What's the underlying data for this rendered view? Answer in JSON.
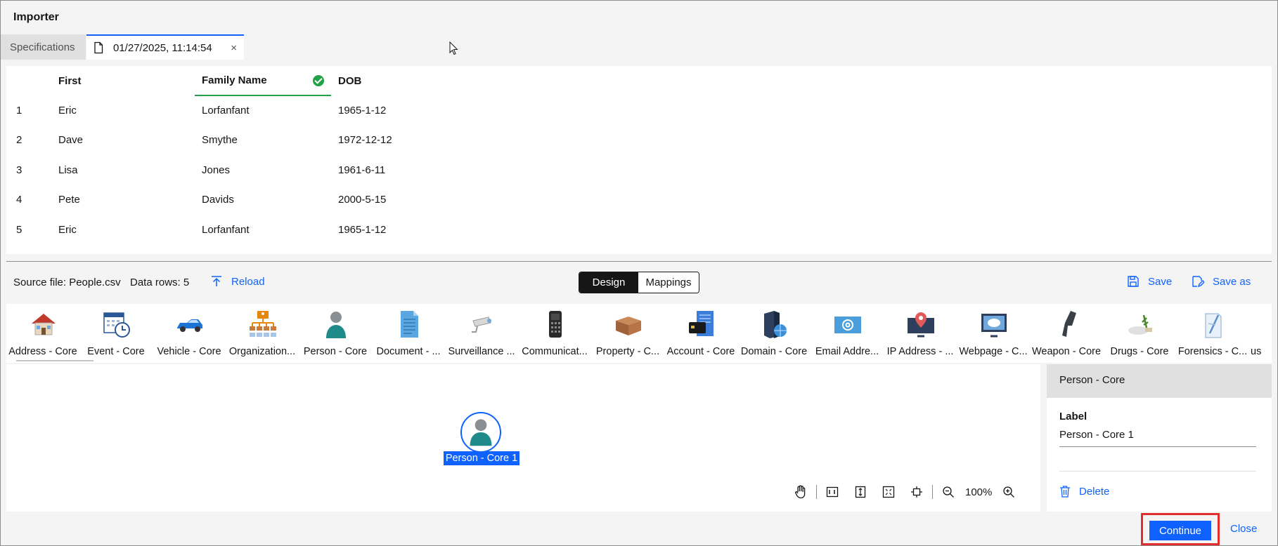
{
  "title": "Importer",
  "tabs": {
    "specifications": "Specifications",
    "file_tab": "01/27/2025, 11:14:54",
    "close_glyph": "×"
  },
  "grid": {
    "headers": [
      "",
      "First",
      "Family Name",
      "DOB"
    ],
    "rows": [
      [
        "1",
        "Eric",
        "Lorfanfant",
        "1965-1-12"
      ],
      [
        "2",
        "Dave",
        "Smythe",
        "1972-12-12"
      ],
      [
        "3",
        "Lisa",
        "Jones",
        "1961-6-11"
      ],
      [
        "4",
        "Pete",
        "Davids",
        "2000-5-15"
      ],
      [
        "5",
        "Eric",
        "Lorfanfant",
        "1965-1-12"
      ]
    ],
    "mapped_column_color": "#24a148"
  },
  "toolbar": {
    "source_file": "Source file: People.csv",
    "data_rows": "Data rows: 5",
    "reload": "Reload",
    "design": "Design",
    "mappings": "Mappings",
    "save": "Save",
    "save_as": "Save as"
  },
  "palette": [
    {
      "label": "Address - Core",
      "icon": "house-icon"
    },
    {
      "label": "Event - Core",
      "icon": "calendar-clock-icon"
    },
    {
      "label": "Vehicle - Core",
      "icon": "car-icon"
    },
    {
      "label": "Organization...",
      "icon": "org-chart-icon"
    },
    {
      "label": "Person - Core",
      "icon": "person-icon"
    },
    {
      "label": "Document - ...",
      "icon": "document-icon"
    },
    {
      "label": "Surveillance ...",
      "icon": "camera-icon"
    },
    {
      "label": "Communicat...",
      "icon": "phone-icon"
    },
    {
      "label": "Property - C...",
      "icon": "box-icon"
    },
    {
      "label": "Account - Core",
      "icon": "card-icon"
    },
    {
      "label": "Domain - Core",
      "icon": "server-globe-icon"
    },
    {
      "label": "Email Addre...",
      "icon": "email-icon"
    },
    {
      "label": "IP Address - ...",
      "icon": "monitor-pin-icon"
    },
    {
      "label": "Webpage - C...",
      "icon": "web-monitor-icon"
    },
    {
      "label": "Weapon - Core",
      "icon": "gun-icon"
    },
    {
      "label": "Drugs - Core",
      "icon": "drugs-icon"
    },
    {
      "label": "Forensics - C...",
      "icon": "forensics-icon"
    },
    {
      "label": "us",
      "icon": ""
    }
  ],
  "canvas": {
    "node_label": "Person - Core 1",
    "zoom": "100%"
  },
  "properties": {
    "header": "Person - Core",
    "label_title": "Label",
    "label_value": "Person - Core 1",
    "delete": "Delete"
  },
  "footer": {
    "continue": "Continue",
    "close": "Close"
  },
  "colors": {
    "accent": "#0f62fe",
    "highlight_box": "#e32e2e"
  }
}
